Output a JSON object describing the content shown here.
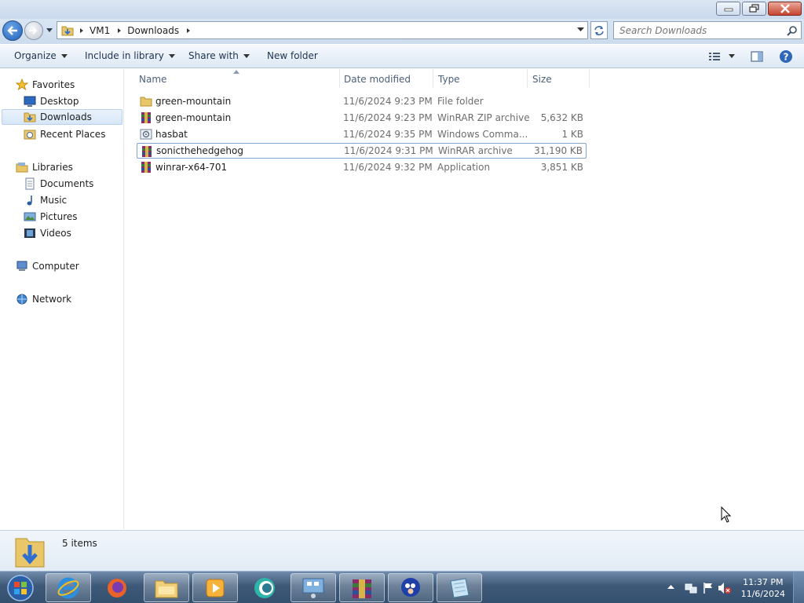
{
  "window": {
    "address": {
      "crumbs": [
        "VM1",
        "Downloads"
      ]
    },
    "search": {
      "placeholder": "Search Downloads"
    }
  },
  "toolbar": {
    "organize": "Organize",
    "include_in_library": "Include in library",
    "share_with": "Share with",
    "new_folder": "New folder"
  },
  "nav": {
    "favorites": {
      "label": "Favorites",
      "items": [
        "Desktop",
        "Downloads",
        "Recent Places"
      ]
    },
    "libraries": {
      "label": "Libraries",
      "items": [
        "Documents",
        "Music",
        "Pictures",
        "Videos"
      ]
    },
    "computer": "Computer",
    "network": "Network",
    "selected": "Downloads"
  },
  "columns": [
    "Name",
    "Date modified",
    "Type",
    "Size"
  ],
  "files": [
    {
      "name": "green-mountain",
      "date": "11/6/2024 9:23 PM",
      "type": "File folder",
      "size": "",
      "icon": "folder-icon"
    },
    {
      "name": "green-mountain",
      "date": "11/6/2024 9:23 PM",
      "type": "WinRAR ZIP archive",
      "size": "5,632 KB",
      "icon": "winrar-archive-icon"
    },
    {
      "name": "hasbat",
      "date": "11/6/2024 9:35 PM",
      "type": "Windows Comma...",
      "size": "1 KB",
      "icon": "batch-file-icon"
    },
    {
      "name": "sonicthehedgehog",
      "date": "11/6/2024 9:31 PM",
      "type": "WinRAR archive",
      "size": "31,190 KB",
      "icon": "winrar-archive-icon"
    },
    {
      "name": "winrar-x64-701",
      "date": "11/6/2024 9:32 PM",
      "type": "Application",
      "size": "3,851 KB",
      "icon": "winrar-installer-icon"
    }
  ],
  "selected_file": "sonicthehedgehog",
  "details": {
    "count": "5 items"
  },
  "taskbar": {
    "apps": [
      "internet-explorer",
      "firefox",
      "windows-explorer",
      "media-player",
      "unknown-app",
      "remote-desktop",
      "winrar",
      "sonic",
      "notepad"
    ],
    "clock": {
      "time": "11:37 PM",
      "date": "11/6/2024"
    }
  },
  "colors": {
    "accent": "#1f5fb8",
    "selection": "#d6e6f8",
    "taskbar": "#3e5878"
  }
}
